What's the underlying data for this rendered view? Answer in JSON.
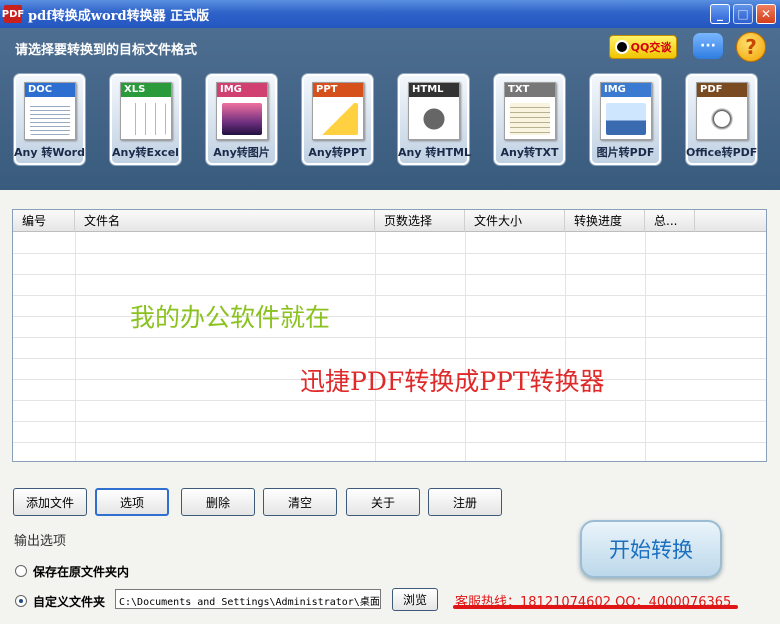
{
  "window": {
    "title": "pdf转换成word转换器 正式版",
    "logo_text": "PDF"
  },
  "header": {
    "prompt": "请选择要转换到的目标文件格式",
    "qq_label": "QQ交谈",
    "chat_label": "···",
    "help_label": "?"
  },
  "formats": [
    {
      "tag": "DOC",
      "label": "Any 转Word",
      "color": "#2d6fd0"
    },
    {
      "tag": "XLS",
      "label": "Any转Excel",
      "color": "#2a9a3a"
    },
    {
      "tag": "IMG",
      "label": "Any转图片",
      "color": "#d04070"
    },
    {
      "tag": "PPT",
      "label": "Any转PPT",
      "color": "#d6501c"
    },
    {
      "tag": "HTML",
      "label": "Any 转HTML",
      "color": "#333333"
    },
    {
      "tag": "TXT",
      "label": "Any转TXT",
      "color": "#777777"
    },
    {
      "tag": "IMG",
      "label": "图片转PDF",
      "color": "#3a7ad0"
    },
    {
      "tag": "PDF",
      "label": "Office转PDF",
      "color": "#7a4a20"
    }
  ],
  "table": {
    "columns": [
      "编号",
      "文件名",
      "页数选择",
      "文件大小",
      "转换进度",
      "总..."
    ]
  },
  "promo": {
    "line1": "我的办公软件就在",
    "line2": "迅捷PDF转换成PPT转换器"
  },
  "buttons": {
    "add": "添加文件",
    "options": "选项",
    "delete": "删除",
    "clear": "清空",
    "about": "关于",
    "register": "注册",
    "browse": "浏览",
    "start": "开始转换"
  },
  "output": {
    "title": "输出选项",
    "option_original": "保存在原文件夹内",
    "option_custom": "自定义文件夹",
    "path": "C:\\Documents and Settings\\Administrator\\桌面"
  },
  "hotline": "客服热线：18121074602 QQ：4000076365"
}
